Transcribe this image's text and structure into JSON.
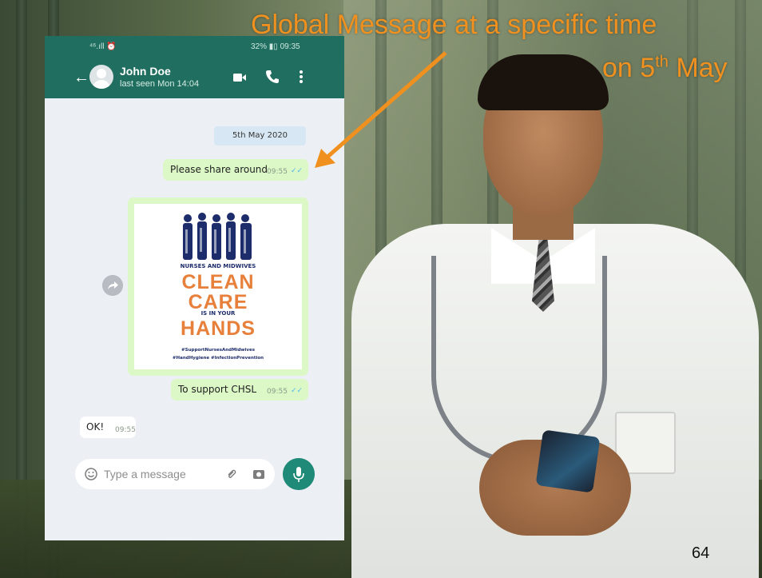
{
  "slide": {
    "headline_line1": "Global Message at a specific time",
    "headline_line2_pre": "on 5",
    "headline_line2_sup": "th",
    "headline_line2_post": " May",
    "page_number": "64",
    "accent_color": "#f0911f"
  },
  "statusbar": {
    "left": "⁴⁶.ıll ⏰",
    "right": "32% ▮▯ 09:35"
  },
  "chat_header": {
    "contact_name": "John Doe",
    "last_seen": "last seen Mon 14:04",
    "icons": [
      "back-arrow-icon",
      "video-call-icon",
      "voice-call-icon",
      "more-options-icon"
    ],
    "header_color": "#1f6e5f"
  },
  "messages": {
    "date_chip": "5th May 2020",
    "items": [
      {
        "text": "Please share around",
        "time": "09:55",
        "ticks": "✓✓",
        "direction": "out"
      },
      {
        "text": "To support CHSL",
        "time": "09:55",
        "ticks": "✓✓",
        "direction": "out"
      },
      {
        "text": "OK!",
        "time": "09:55",
        "direction": "in"
      }
    ],
    "bubble_out_color": "#dcf8c6"
  },
  "poster": {
    "line1": "NURSES AND MIDWIVES",
    "line2": "CLEAN",
    "line3": "CARE",
    "line4": "IS IN YOUR",
    "line5": "HANDS",
    "tags1": "#SupportNursesAndMidwives",
    "tags2": "#HandHygiene #InfectionPrevention"
  },
  "composer": {
    "placeholder": "Type a message",
    "icons": [
      "emoji-icon",
      "attach-icon",
      "camera-icon",
      "mic-icon"
    ]
  }
}
